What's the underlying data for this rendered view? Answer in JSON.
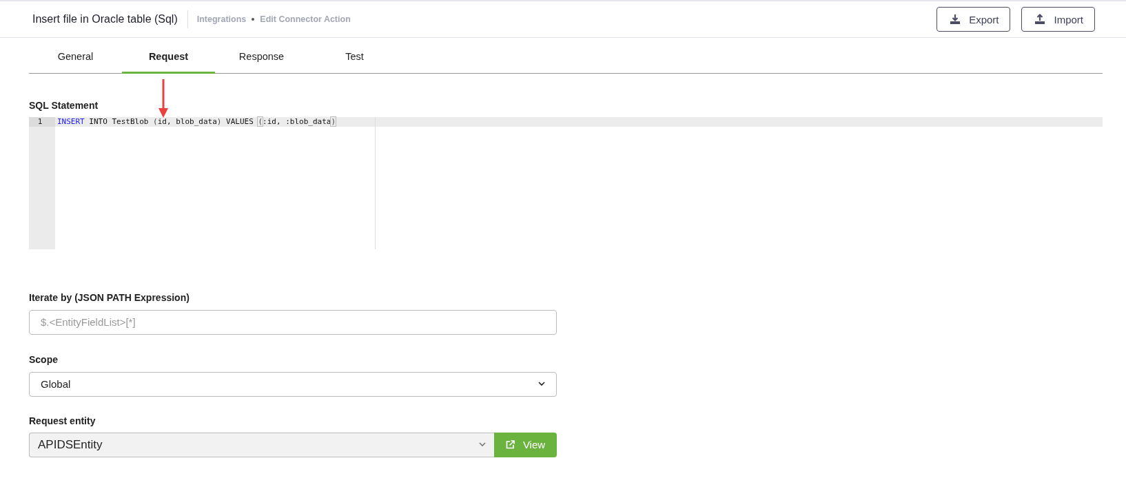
{
  "header": {
    "title": "Insert file in Oracle table (Sql)",
    "breadcrumbs": [
      "Integrations",
      "Edit Connector Action"
    ],
    "buttons": [
      {
        "label": "Export",
        "kind": "export"
      },
      {
        "label": "Import",
        "kind": "import"
      }
    ]
  },
  "tabs": [
    {
      "label": "General",
      "selected": false
    },
    {
      "label": "Request",
      "selected": true
    },
    {
      "label": "Response",
      "selected": false
    },
    {
      "label": "Test",
      "selected": false
    }
  ],
  "sql": {
    "label": "SQL Statement",
    "lines": [
      {
        "number": "1",
        "tokens": [
          {
            "text": "INSERT",
            "kind": "keyword",
            "matched": false
          },
          {
            "text": " INTO TestBlob ",
            "kind": "plain",
            "matched": false
          },
          {
            "text": "(",
            "kind": "paren",
            "matched": false
          },
          {
            "text": "id, blob_data",
            "kind": "plain",
            "matched": false
          },
          {
            "text": ")",
            "kind": "paren",
            "matched": false
          },
          {
            "text": " VALUES ",
            "kind": "plain",
            "matched": false
          },
          {
            "text": "(",
            "kind": "paren",
            "matched": true
          },
          {
            "text": ":id, :blob_data",
            "kind": "plain",
            "matched": false
          },
          {
            "text": ")",
            "kind": "paren",
            "matched": true
          }
        ]
      }
    ]
  },
  "iterate": {
    "label": "Iterate by (JSON PATH Expression)",
    "placeholder": "$.<EntityFieldList>[*]"
  },
  "scope": {
    "label": "Scope",
    "value": "Global"
  },
  "request_entity": {
    "label": "Request entity",
    "value": "APIDSEntity",
    "button": "View"
  }
}
